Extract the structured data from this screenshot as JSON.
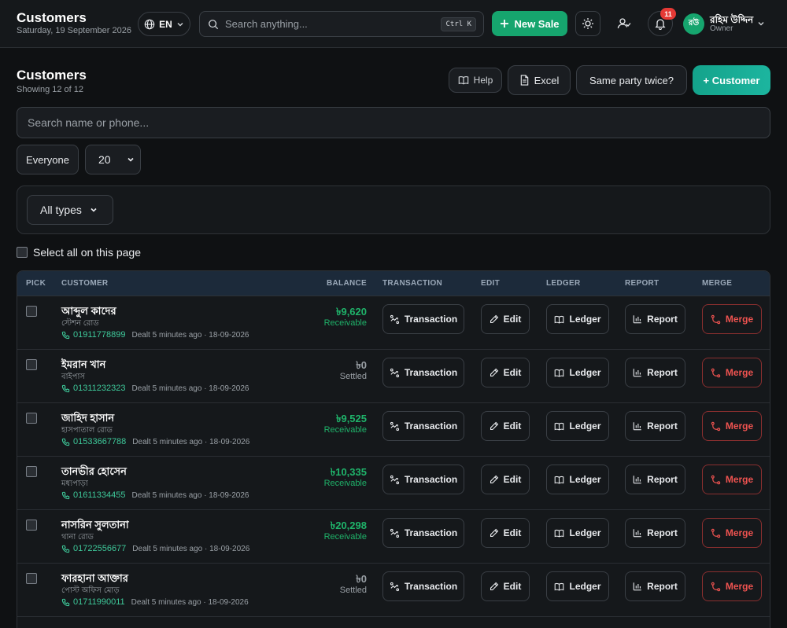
{
  "topbar": {
    "title": "Customers",
    "date": "Saturday, 19 September 2026",
    "language": "EN",
    "search_placeholder": "Search anything...",
    "search_shortcut": "Ctrl K",
    "new_sale_label": "New Sale",
    "notification_count": "11",
    "user_initials": "রউ",
    "user_name": "রহিম উদ্দিন",
    "user_role": "Owner"
  },
  "header": {
    "title": "Customers",
    "subtitle": "Showing 12 of 12",
    "help_label": "Help",
    "excel_label": "Excel",
    "duplicate_label": "Same party twice?",
    "add_label": "+ Customer"
  },
  "filters": {
    "search_placeholder": "Search name or phone...",
    "audience": "Everyone",
    "page_size": "20",
    "type": "All types",
    "select_all_label": "Select all on this page"
  },
  "table": {
    "columns": {
      "pick": "PICK",
      "customer": "CUSTOMER",
      "balance": "BALANCE",
      "transaction": "TRANSACTION",
      "edit": "EDIT",
      "ledger": "LEDGER",
      "report": "REPORT",
      "merge": "MERGE"
    },
    "actions": {
      "transaction": "Transaction",
      "edit": "Edit",
      "ledger": "Ledger",
      "report": "Report",
      "merge": "Merge"
    },
    "rows": [
      {
        "name": "আব্দুল কাদের",
        "area": "স্টেশন রোড",
        "phone": "01911778899",
        "dealt": "Dealt 5 minutes ago · 18-09-2026",
        "balance": "৳9,620",
        "status": "Receivable",
        "receivable": true
      },
      {
        "name": "ইমরান খান",
        "area": "বাইপাস",
        "phone": "01311232323",
        "dealt": "Dealt 5 minutes ago · 18-09-2026",
        "balance": "৳0",
        "status": "Settled",
        "receivable": false
      },
      {
        "name": "জাহিদ হাসান",
        "area": "হাসপাতাল রোড",
        "phone": "01533667788",
        "dealt": "Dealt 5 minutes ago · 18-09-2026",
        "balance": "৳9,525",
        "status": "Receivable",
        "receivable": true
      },
      {
        "name": "তানভীর হোসেন",
        "area": "মধ্যপাড়া",
        "phone": "01611334455",
        "dealt": "Dealt 5 minutes ago · 18-09-2026",
        "balance": "৳10,335",
        "status": "Receivable",
        "receivable": true
      },
      {
        "name": "নাসরিন সুলতানা",
        "area": "থানা রোড",
        "phone": "01722556677",
        "dealt": "Dealt 5 minutes ago · 18-09-2026",
        "balance": "৳20,298",
        "status": "Receivable",
        "receivable": true
      },
      {
        "name": "ফারহানা আক্তার",
        "area": "পোস্ট অফিস মোড়",
        "phone": "01711990011",
        "dealt": "Dealt 5 minutes ago · 18-09-2026",
        "balance": "৳0",
        "status": "Settled",
        "receivable": false
      }
    ]
  },
  "colors": {
    "accent": "#16a56e",
    "receivable": "#1fb36a",
    "merge": "#ef5350",
    "header_bg": "#1c2a3a"
  }
}
